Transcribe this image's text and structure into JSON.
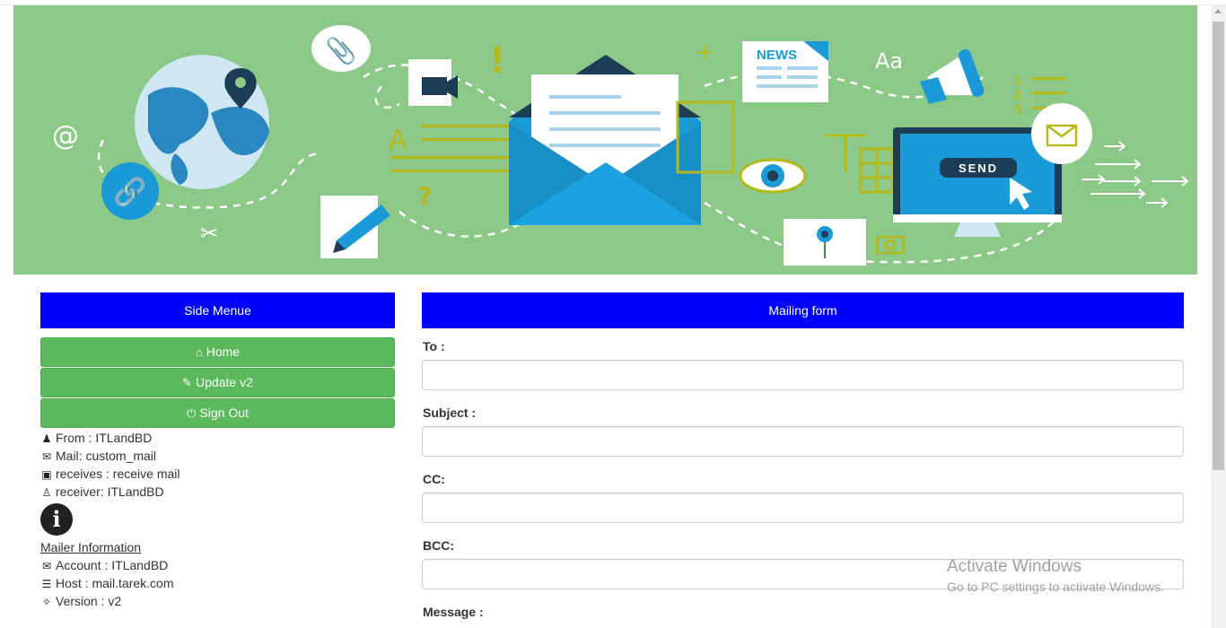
{
  "colors": {
    "panel_header": "#0000ff",
    "button": "#5cb85c",
    "banner_bg": "#8cc887"
  },
  "banner": {
    "news_text": "NEWS",
    "send_text": "SEND",
    "numbers": [
      "1",
      "2",
      "3"
    ],
    "at_symbol": "@",
    "font_symbol": "Aa",
    "letter_a": "A",
    "question": "?"
  },
  "sidebar": {
    "title": "Side Menue",
    "buttons": [
      {
        "label": "Home",
        "icon": "home-icon"
      },
      {
        "label": "Update v2",
        "icon": "edit-icon"
      },
      {
        "label": "Sign Out",
        "icon": "power-icon"
      }
    ],
    "info": [
      {
        "text": "From : ITLandBD",
        "icon": "user-icon"
      },
      {
        "text": "Mail: custom_mail",
        "icon": "envelope-icon"
      },
      {
        "text": "receives : receive mail",
        "icon": "inbox-icon"
      },
      {
        "text": "receiver: ITLandBD",
        "icon": "user-outline-icon"
      }
    ],
    "mailer_link": "Mailer Information",
    "mailer_info": [
      {
        "text": "Account : ITLandBD",
        "icon": "envelope-icon"
      },
      {
        "text": "Host : mail.tarek.com",
        "icon": "server-icon"
      },
      {
        "text": "Version : v2",
        "icon": "puzzle-icon"
      }
    ]
  },
  "form": {
    "title": "Mailing form",
    "fields": [
      {
        "label": "To :",
        "value": ""
      },
      {
        "label": "Subject :",
        "value": ""
      },
      {
        "label": "CC:",
        "value": ""
      },
      {
        "label": "BCC:",
        "value": ""
      }
    ],
    "message_label": "Message :"
  },
  "watermark": {
    "line1": "Activate Windows",
    "line2": "Go to PC settings to activate Windows."
  }
}
